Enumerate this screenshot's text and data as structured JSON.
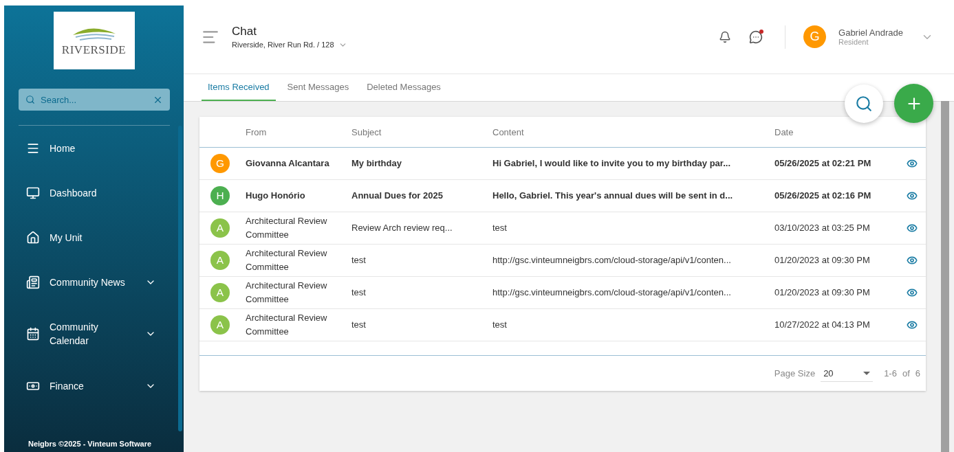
{
  "sidebar": {
    "logo": "RIVERSIDE",
    "search": {
      "placeholder": "Search..."
    },
    "items": [
      {
        "label": "Home",
        "expandable": false
      },
      {
        "label": "Dashboard",
        "expandable": false
      },
      {
        "label": "My Unit",
        "expandable": false
      },
      {
        "label": "Community News",
        "expandable": true
      },
      {
        "label": "Community Calendar",
        "expandable": true
      },
      {
        "label": "Finance",
        "expandable": true
      }
    ],
    "footer": "Neigbrs ©2025 - Vinteum Software"
  },
  "header": {
    "title": "Chat",
    "location": "Riverside, River Run Rd. / 128",
    "has_new_messages": true,
    "user": {
      "initial": "G",
      "name": "Gabriel Andrade",
      "role": "Resident"
    }
  },
  "tabs": [
    {
      "label": "Items Received",
      "selected": true
    },
    {
      "label": "Sent Messages",
      "selected": false
    },
    {
      "label": "Deleted Messages",
      "selected": false
    }
  ],
  "table": {
    "columns": [
      "From",
      "Subject",
      "Content",
      "Date"
    ],
    "rows": [
      {
        "initial": "G",
        "color": "#ff9800",
        "from": "Giovanna Alcantara",
        "subject": "My birthday",
        "content": "Hi Gabriel, I would like to invite you to my birthday par...",
        "date": "05/26/2025 at 02:21 PM",
        "unread": true
      },
      {
        "initial": "H",
        "color": "#4caf50",
        "from": "Hugo Honório",
        "subject": "Annual Dues for 2025",
        "content": "Hello, Gabriel. This year's annual dues will be sent in d...",
        "date": "05/26/2025 at 02:16 PM",
        "unread": true
      },
      {
        "initial": "A",
        "color": "#8bc34a",
        "from": "Architectural Review Committee",
        "subject": "Review Arch review req...",
        "content": "test",
        "date": "03/10/2023 at 03:25 PM",
        "unread": false
      },
      {
        "initial": "A",
        "color": "#8bc34a",
        "from": "Architectural Review Committee",
        "subject": "test",
        "content": "http://gsc.vinteumneigbrs.com/cloud-storage/api/v1/conten...",
        "date": "01/20/2023 at 09:30 PM",
        "unread": false
      },
      {
        "initial": "A",
        "color": "#8bc34a",
        "from": "Architectural Review Committee",
        "subject": "test",
        "content": "http://gsc.vinteumneigbrs.com/cloud-storage/api/v1/conten...",
        "date": "01/20/2023 at 09:30 PM",
        "unread": false
      },
      {
        "initial": "A",
        "color": "#8bc34a",
        "from": "Architectural Review Committee",
        "subject": "test",
        "content": "test",
        "date": "10/27/2022 at 04:13 PM",
        "unread": false
      }
    ]
  },
  "pager": {
    "label": "Page Size",
    "size": "20",
    "range": "1-6",
    "of": "of",
    "total": "6"
  }
}
